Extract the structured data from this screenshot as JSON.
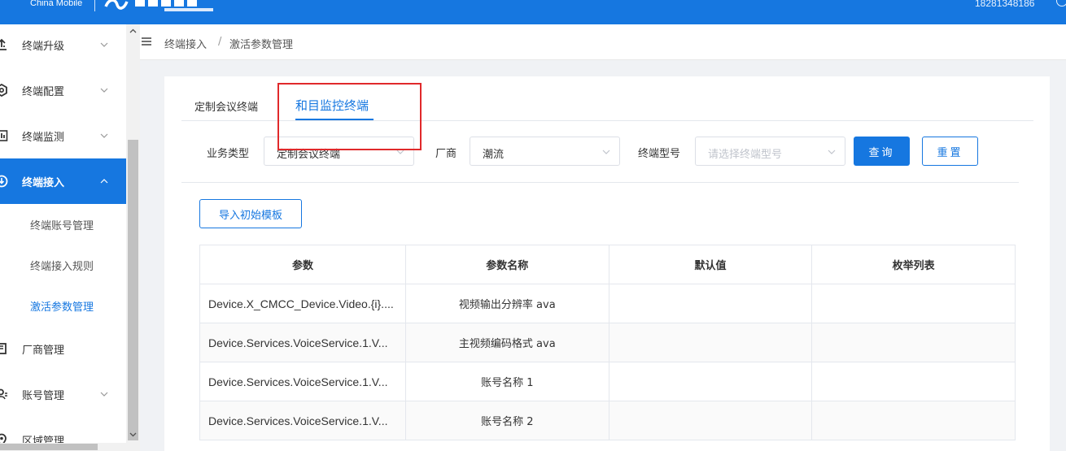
{
  "header": {
    "brand_text": "China Mobile",
    "user_number": "18281348186",
    "colors": {
      "primary": "#1677e0",
      "highlight": "#e0292b"
    }
  },
  "sidebar": {
    "items": [
      {
        "label": "终端升级",
        "icon": "upgrade-icon",
        "has_chevron": true,
        "chevron": "down"
      },
      {
        "label": "终端配置",
        "icon": "config-icon",
        "has_chevron": true,
        "chevron": "down"
      },
      {
        "label": "终端监测",
        "icon": "monitor-icon",
        "has_chevron": true,
        "chevron": "down"
      },
      {
        "label": "终端接入",
        "icon": "access-icon",
        "has_chevron": true,
        "chevron": "up",
        "active": true
      },
      {
        "label": "厂商管理",
        "icon": "vendor-icon",
        "has_chevron": false
      },
      {
        "label": "账号管理",
        "icon": "account-icon",
        "has_chevron": true,
        "chevron": "down"
      },
      {
        "label": "区域管理",
        "icon": "region-icon",
        "has_chevron": false
      }
    ],
    "sub_items": [
      {
        "label": "终端账号管理"
      },
      {
        "label": "终端接入规则"
      },
      {
        "label": "激活参数管理",
        "current": true
      }
    ]
  },
  "breadcrumb": [
    "终端接入",
    "/",
    "激活参数管理"
  ],
  "tabs": [
    {
      "label": "定制会议终端",
      "active": false
    },
    {
      "label": "和目监控终端",
      "active": true
    }
  ],
  "filters": {
    "business_type_label": "业务类型",
    "business_type_value": "定制会议终端",
    "vendor_label": "厂商",
    "vendor_value": "潮流",
    "model_label": "终端型号",
    "model_placeholder": "请选择终端型号",
    "search_button": "查询",
    "reset_button": "重置"
  },
  "import_button": "导入初始模板",
  "table": {
    "columns": [
      "参数",
      "参数名称",
      "默认值",
      "枚举列表"
    ],
    "rows": [
      {
        "param": "Device.X_CMCC_Device.Video.{i}....",
        "name": "视频输出分辨率 ava",
        "default": "",
        "enum": ""
      },
      {
        "param": "Device.Services.VoiceService.1.V...",
        "name": "主视频编码格式 ava",
        "default": "",
        "enum": ""
      },
      {
        "param": "Device.Services.VoiceService.1.V...",
        "name": "账号名称 1",
        "default": "",
        "enum": ""
      },
      {
        "param": "Device.Services.VoiceService.1.V...",
        "name": "账号名称 2",
        "default": "",
        "enum": ""
      }
    ]
  }
}
